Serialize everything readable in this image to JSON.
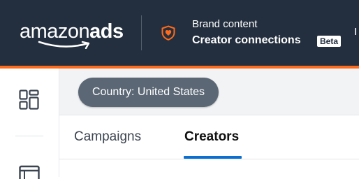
{
  "header": {
    "logo_text_light": "amazon",
    "logo_text_bold": "ads",
    "brand_label": "Brand content",
    "app_title": "Creator connections",
    "badge": "Beta",
    "brand_icon": "shield-heart-icon"
  },
  "colors": {
    "header_bg": "#232f3e",
    "accent": "#ff6b1a",
    "chip_bg": "#5b6775",
    "active_tab": "#0a6fd0"
  },
  "sidebar": {
    "items": [
      {
        "icon": "dashboard-grid-icon"
      },
      {
        "icon": "calendar-icon"
      }
    ]
  },
  "filter": {
    "country_label": "Country: United States"
  },
  "tabs": [
    {
      "label": "Campaigns",
      "active": false
    },
    {
      "label": "Creators",
      "active": true
    }
  ]
}
